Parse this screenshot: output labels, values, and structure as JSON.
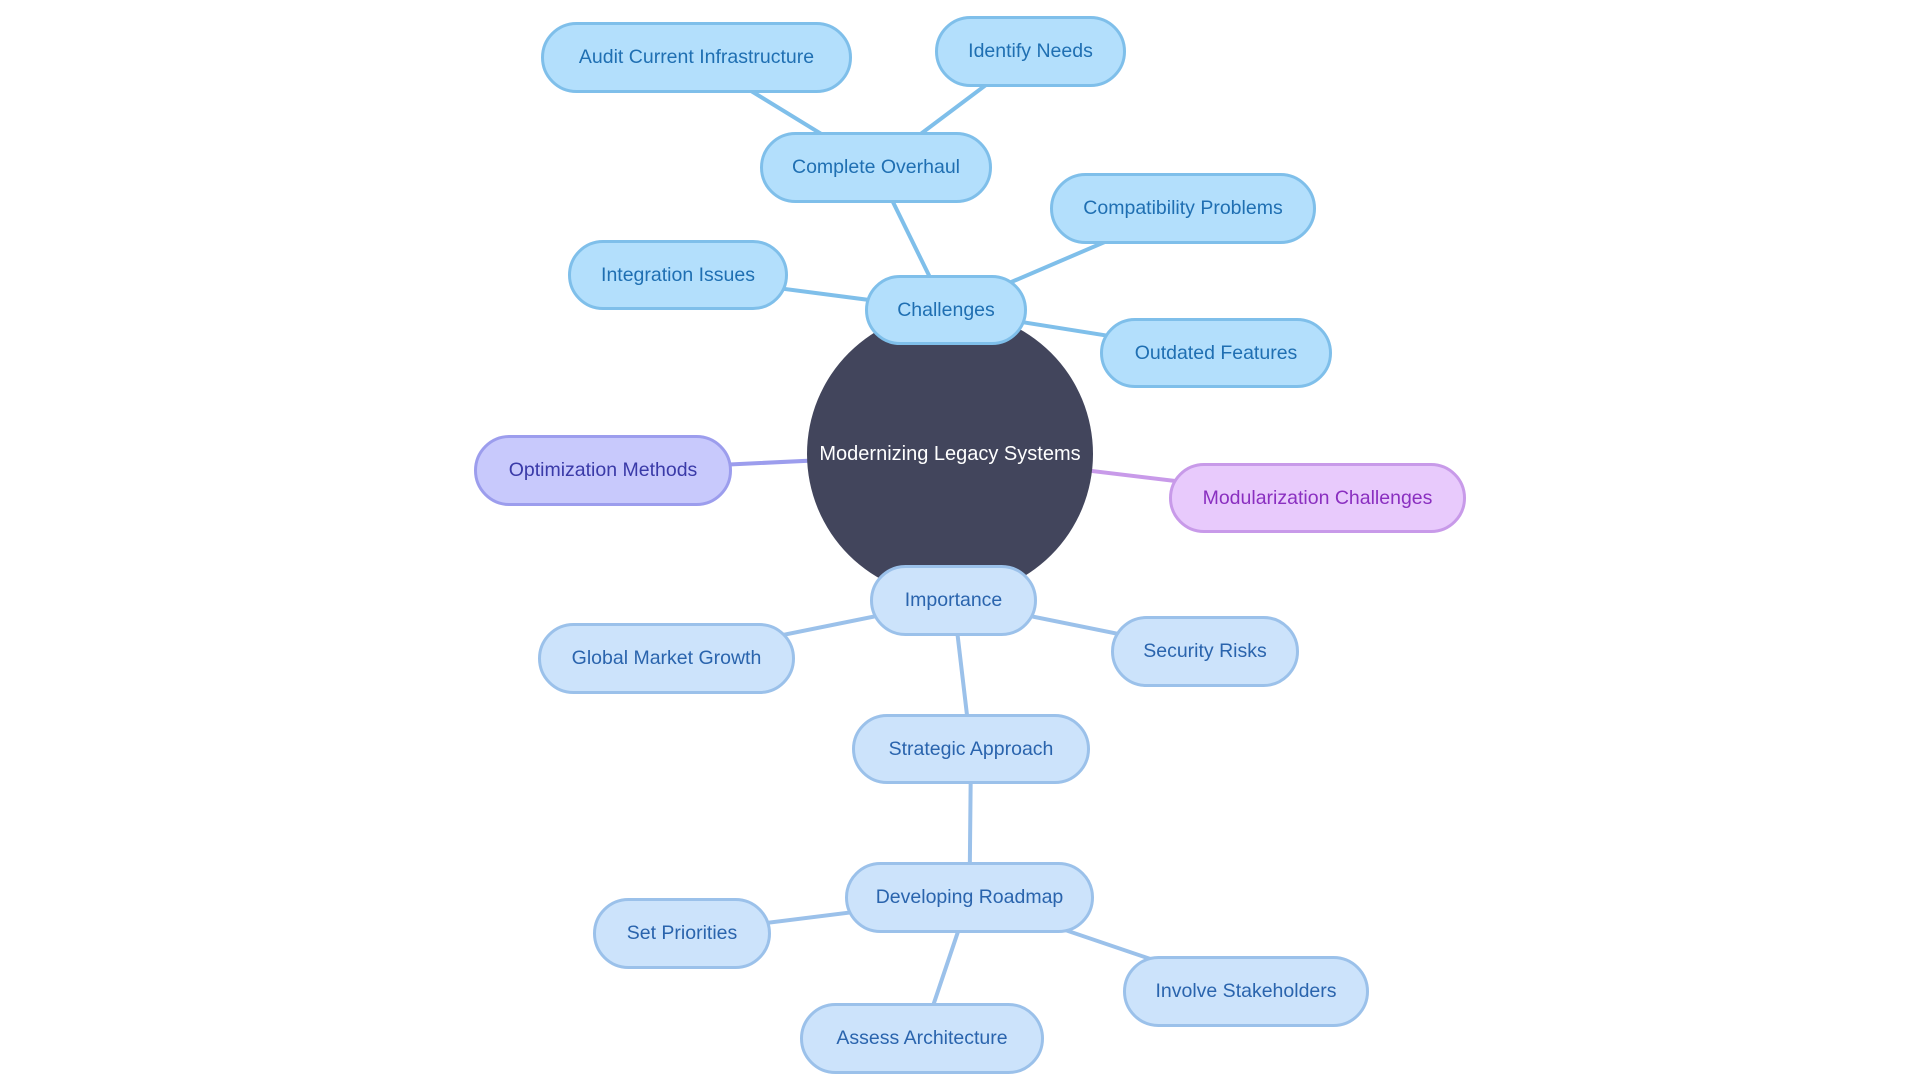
{
  "diagram": {
    "type": "mindmap",
    "root": {
      "id": "root",
      "label": "Modernizing Legacy Systems",
      "color": "#42455c"
    },
    "palette": {
      "blue": {
        "fill": "#b3dffc",
        "stroke": "#7fbfea",
        "text": "#1f6fb2"
      },
      "light": {
        "fill": "#cce3fb",
        "stroke": "#9bc1ea",
        "text": "#2a64ad"
      },
      "violet": {
        "fill": "#c8c9fc",
        "stroke": "#9c9ded",
        "text": "#3a3aa8"
      },
      "purple": {
        "fill": "#e8cafc",
        "stroke": "#c89ae9",
        "text": "#8a2fc0"
      }
    },
    "nodes": [
      {
        "id": "challenges",
        "label": "Challenges",
        "parent": "root",
        "theme": "blue"
      },
      {
        "id": "complete_overhaul",
        "label": "Complete Overhaul",
        "parent": "challenges",
        "theme": "blue"
      },
      {
        "id": "audit",
        "label": "Audit Current Infrastructure",
        "parent": "complete_overhaul",
        "theme": "blue"
      },
      {
        "id": "identify_needs",
        "label": "Identify Needs",
        "parent": "complete_overhaul",
        "theme": "blue"
      },
      {
        "id": "compatibility",
        "label": "Compatibility Problems",
        "parent": "challenges",
        "theme": "blue"
      },
      {
        "id": "integration",
        "label": "Integration Issues",
        "parent": "challenges",
        "theme": "blue"
      },
      {
        "id": "outdated",
        "label": "Outdated Features",
        "parent": "challenges",
        "theme": "blue"
      },
      {
        "id": "optimization",
        "label": "Optimization Methods",
        "parent": "root",
        "theme": "violet"
      },
      {
        "id": "modularization",
        "label": "Modularization Challenges",
        "parent": "root",
        "theme": "purple"
      },
      {
        "id": "importance",
        "label": "Importance",
        "parent": "root",
        "theme": "light"
      },
      {
        "id": "global_market",
        "label": "Global Market Growth",
        "parent": "importance",
        "theme": "light"
      },
      {
        "id": "security",
        "label": "Security Risks",
        "parent": "importance",
        "theme": "light"
      },
      {
        "id": "strategic",
        "label": "Strategic Approach",
        "parent": "importance",
        "theme": "light"
      },
      {
        "id": "roadmap",
        "label": "Developing Roadmap",
        "parent": "strategic",
        "theme": "light"
      },
      {
        "id": "set_priorities",
        "label": "Set Priorities",
        "parent": "roadmap",
        "theme": "light"
      },
      {
        "id": "stakeholders",
        "label": "Involve Stakeholders",
        "parent": "roadmap",
        "theme": "light"
      },
      {
        "id": "assess",
        "label": "Assess Architecture",
        "parent": "roadmap",
        "theme": "light"
      }
    ]
  }
}
